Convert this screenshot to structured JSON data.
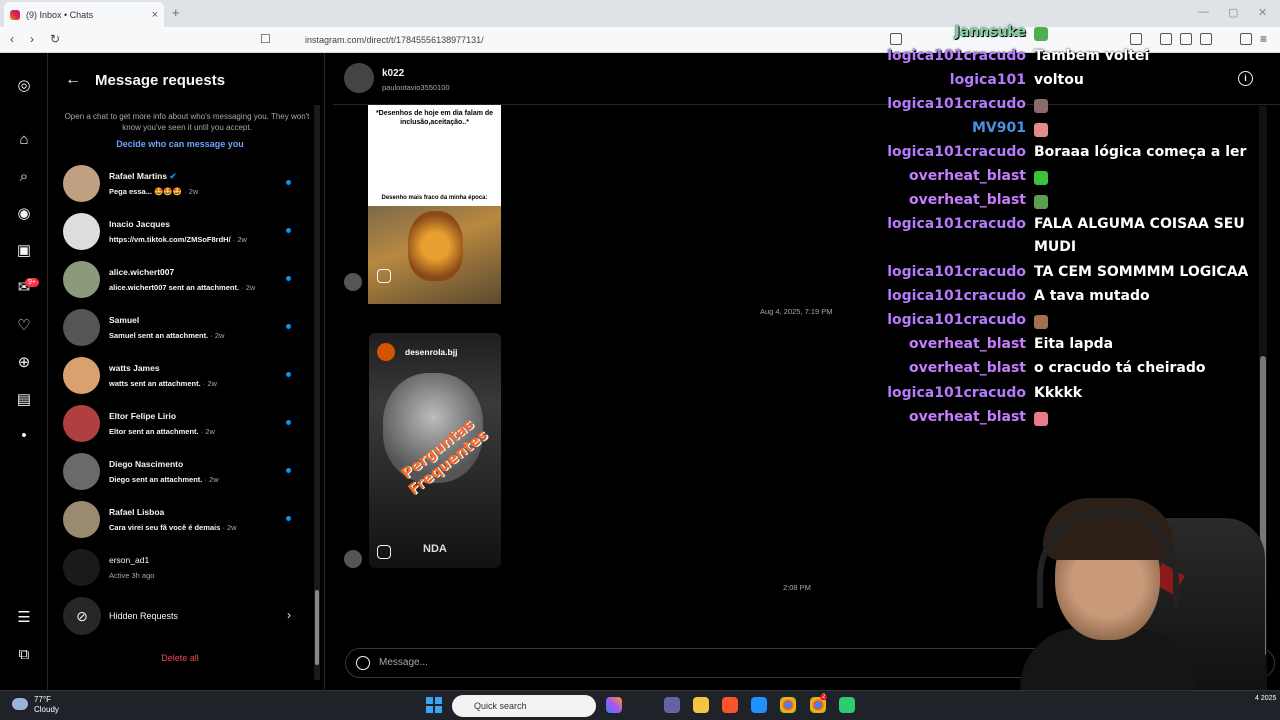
{
  "browser": {
    "tab_title": "(9) Inbox • Chats",
    "url": "instagram.com/direct/t/17845556138977131/",
    "tab_close": "×",
    "new_tab": "+"
  },
  "requests": {
    "back": "←",
    "title": "Message requests",
    "info": "Open a chat to get more info about who's messaging you. They won't know you've seen it until you accept.",
    "decide_link": "Decide who can message you",
    "items": [
      {
        "name": "Rafael Martins",
        "preview": "Pega essa... 🤩🤩🤩",
        "ago": "· 2w",
        "verified": true
      },
      {
        "name": "Inacio Jacques",
        "preview": "https://vm.tiktok.com/ZMSoF8rdH/",
        "ago": "· 2w"
      },
      {
        "name": "alice.wichert007",
        "preview": "alice.wichert007 sent an attachment.",
        "ago": "· 2w"
      },
      {
        "name": "Samuel",
        "preview": "Samuel sent an attachment.",
        "ago": "· 2w"
      },
      {
        "name": "watts James",
        "preview": "watts sent an attachment.",
        "ago": "· 2w"
      },
      {
        "name": "Eltor Felipe Lirio",
        "preview": "Eltor sent an attachment.",
        "ago": "· 2w"
      },
      {
        "name": "Diego Nascimento",
        "preview": "Diego sent an attachment.",
        "ago": "· 2w"
      },
      {
        "name": "Rafael Lisboa",
        "preview": "Cara virei seu fã você é demais",
        "ago": "· 2w"
      },
      {
        "name": "erson_ad1",
        "preview": "Active 3h ago",
        "ago": ""
      }
    ],
    "hidden": "Hidden Requests",
    "delete_all": "Delete all"
  },
  "chat": {
    "name": "k022",
    "username": "paulootavio3550100",
    "meme_caption": "*Desenhos de hoje em dia falam de inclusão,aceitação..*",
    "meme_caption2": "Desenho mais fraco da minha época:",
    "timestamp1": "Aug 4, 2025, 7:19 PM",
    "timestamp2": "2:08 PM",
    "reel_account": "desenrola.bjj",
    "reel_title": "Perguntas Frequentes",
    "reel_bottom": "NDA",
    "message_placeholder": "Message..."
  },
  "stream_chat": [
    {
      "user": "Jannsuke",
      "color": "#7fd3a0",
      "text": "",
      "emote": "#4caf50"
    },
    {
      "user": "logica101cracudo",
      "color": "#b57bff",
      "text": "Tambem voltei"
    },
    {
      "user": "logica101",
      "color": "#b57bff",
      "text": "voltou"
    },
    {
      "user": "logica101cracudo",
      "color": "#b57bff",
      "text": "",
      "emote": "#8a6b6b"
    },
    {
      "user": "MV901",
      "color": "#4a90e2",
      "text": "",
      "emote": "#e58a8a"
    },
    {
      "user": "logica101cracudo",
      "color": "#b57bff",
      "text": "Boraaa lógica começa a ler"
    },
    {
      "user": "overheat_blast",
      "color": "#c77dff",
      "text": "",
      "emote": "#3cc33c"
    },
    {
      "user": "overheat_blast",
      "color": "#c77dff",
      "text": "",
      "emote": "#5aa050"
    },
    {
      "user": "logica101cracudo",
      "color": "#b57bff",
      "text": "FALA ALGUMA COISAA SEU"
    },
    {
      "user": "",
      "color": "#b57bff",
      "text": "MUDI"
    },
    {
      "user": "logica101cracudo",
      "color": "#b57bff",
      "text": "TA CEM SOMMMM LOGICAA"
    },
    {
      "user": "logica101cracudo",
      "color": "#b57bff",
      "text": "A tava mutado"
    },
    {
      "user": "logica101cracudo",
      "color": "#b57bff",
      "text": "",
      "emote": "#a07050"
    },
    {
      "user": "overheat_blast",
      "color": "#c77dff",
      "text": "Eita lapda"
    },
    {
      "user": "overheat_blast",
      "color": "#c77dff",
      "text": "o cracudo tá cheirado"
    },
    {
      "user": "logica101cracudo",
      "color": "#b57bff",
      "text": "Kkkkk"
    },
    {
      "user": "overheat_blast",
      "color": "#c77dff",
      "text": "",
      "emote": "#e87a8a"
    }
  ],
  "taskbar": {
    "temp": "77°F",
    "weather": "Cloudy",
    "search_placeholder": "Quick search",
    "notif_badge": "2",
    "corner_text": "4\n2025"
  },
  "rail_badge": "9+"
}
